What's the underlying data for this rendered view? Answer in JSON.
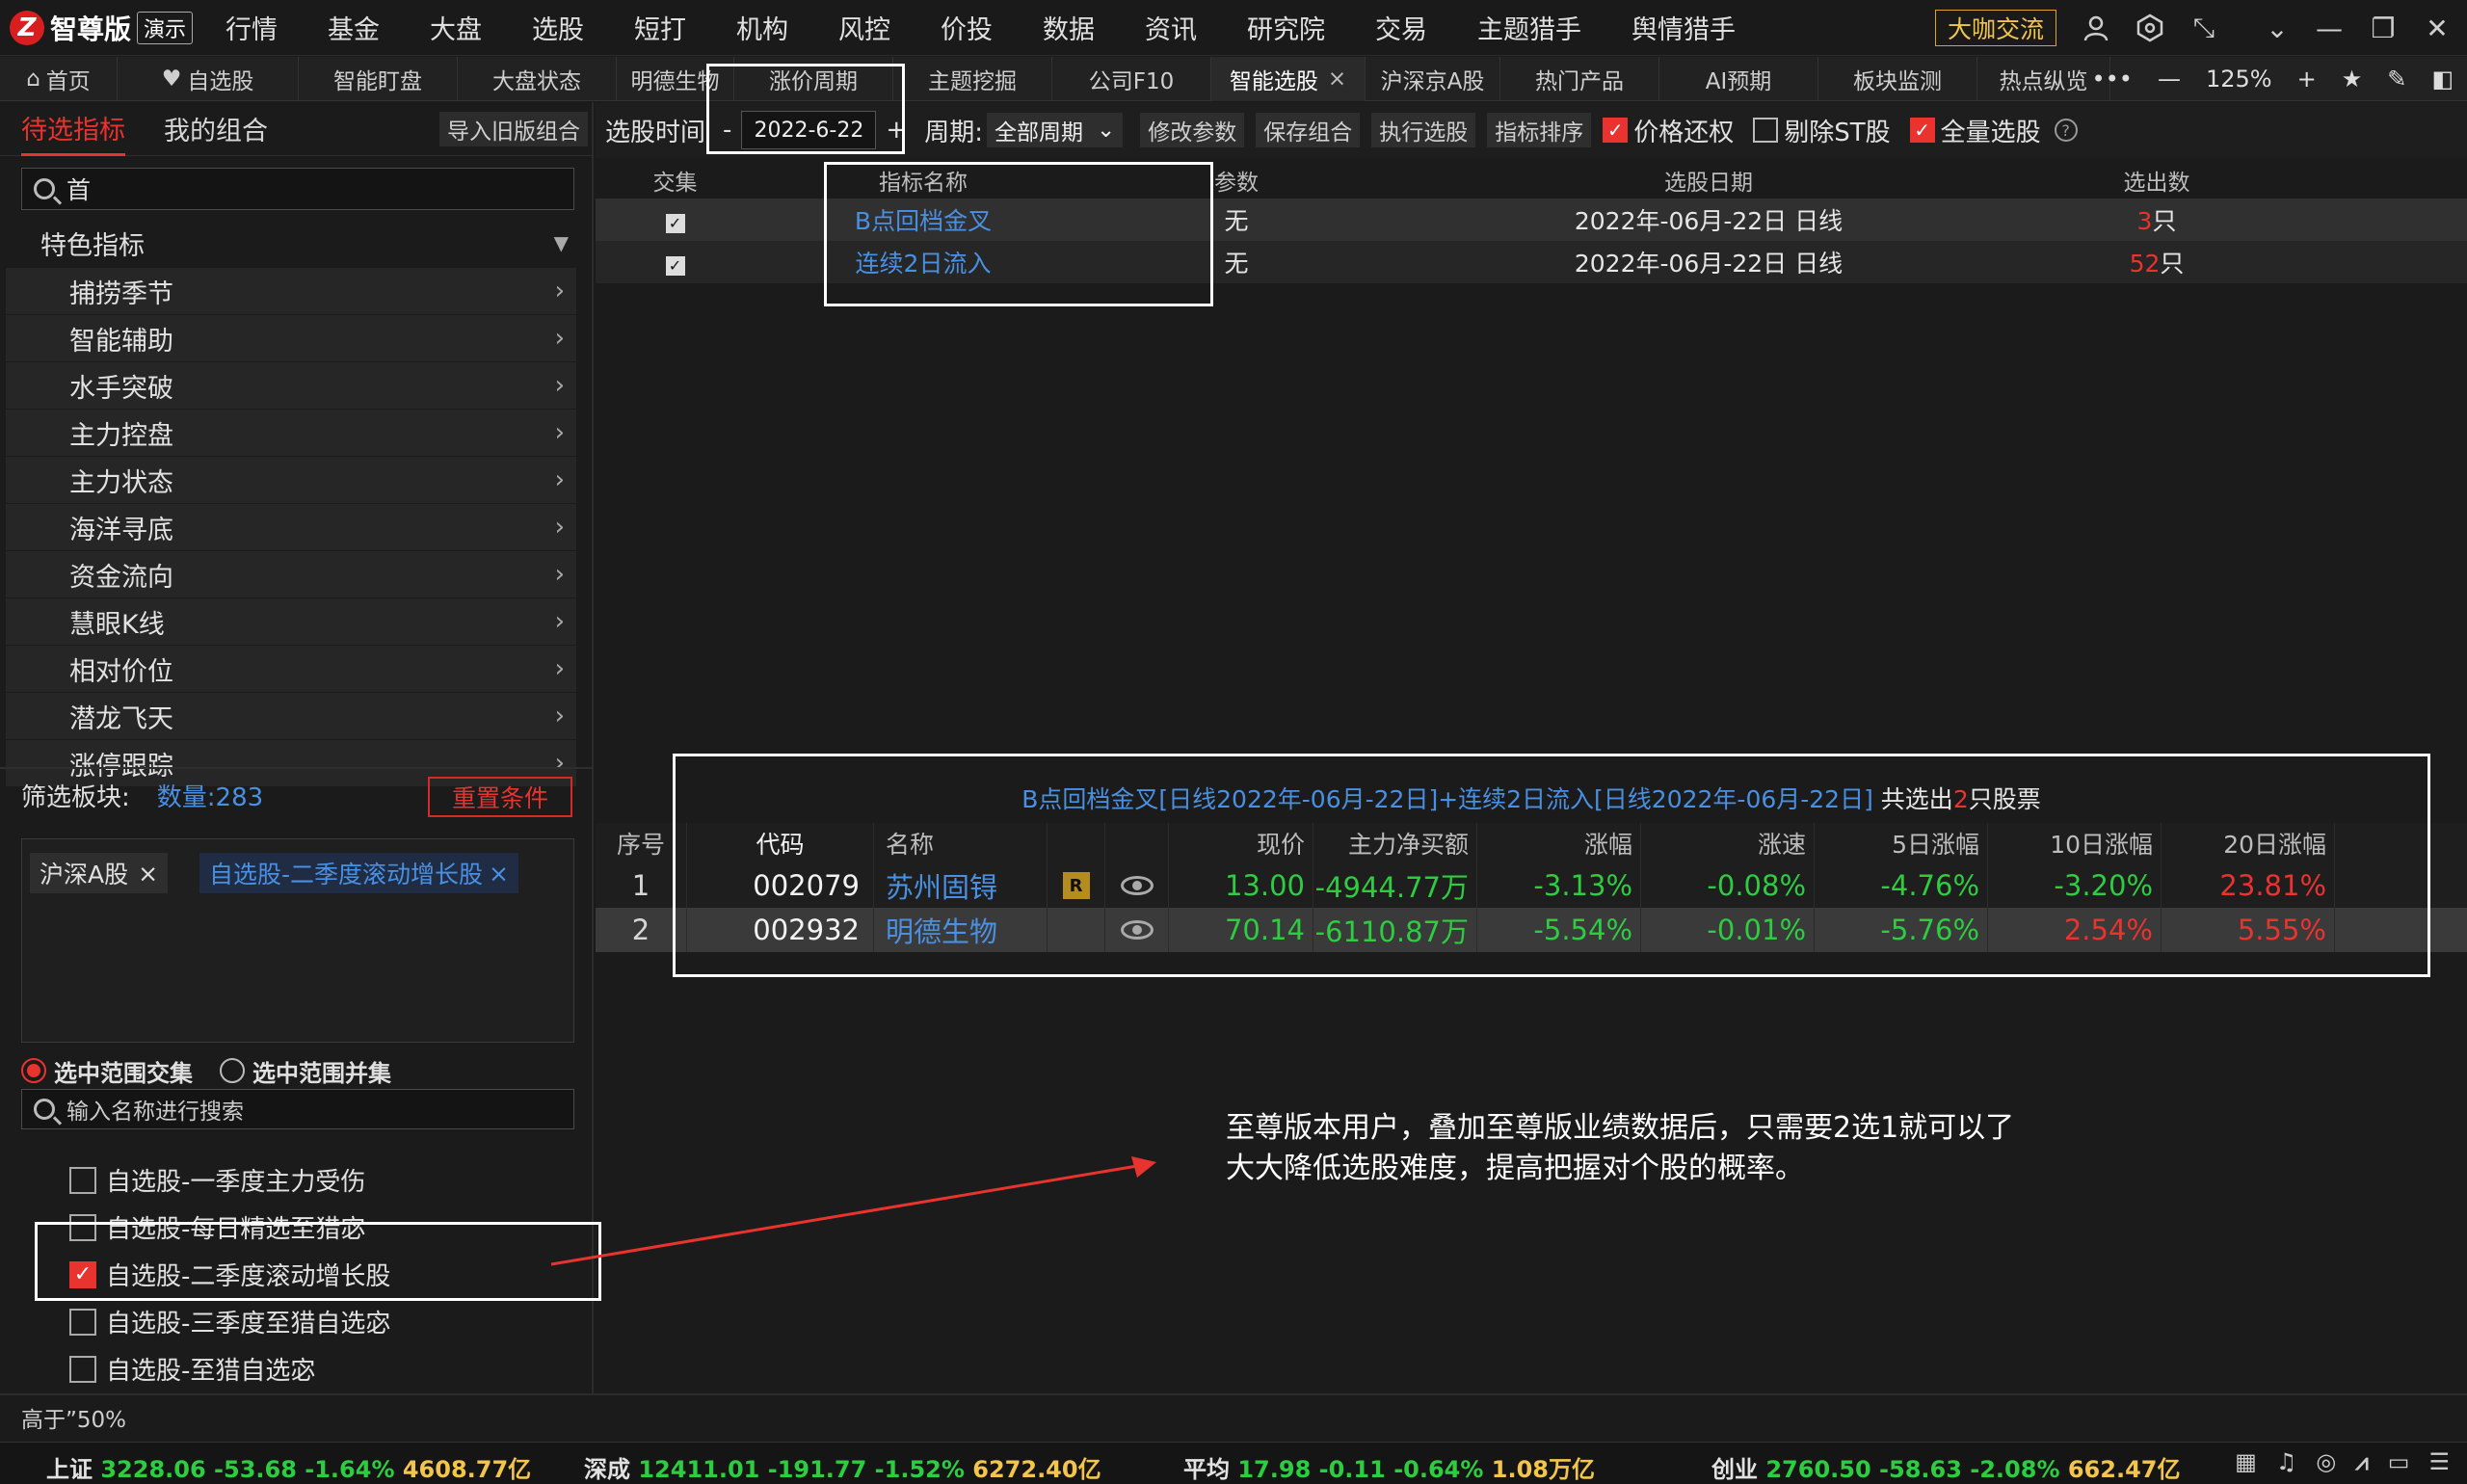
{
  "app": {
    "logo_text": "智尊版",
    "demo_badge": "演示",
    "exchange_btn": "大咖交流"
  },
  "menu": [
    "行情",
    "基金",
    "大盘",
    "选股",
    "短打",
    "机构",
    "风控",
    "价投",
    "数据",
    "资讯",
    "研究院",
    "交易",
    "主题猎手",
    "舆情猎手"
  ],
  "tabs": [
    {
      "label": "首页",
      "icon": "home-icon"
    },
    {
      "label": "自选股",
      "icon": "heart-icon"
    },
    {
      "label": "智能盯盘"
    },
    {
      "label": "大盘状态"
    },
    {
      "label": "明德生物"
    },
    {
      "label": "涨价周期"
    },
    {
      "label": "主题挖掘"
    },
    {
      "label": "公司F10"
    },
    {
      "label": "智能选股",
      "active": true,
      "close": "×"
    },
    {
      "label": "沪深京A股"
    },
    {
      "label": "热门产品"
    },
    {
      "label": "AI预期"
    },
    {
      "label": "板块监测"
    },
    {
      "label": "热点纵览"
    }
  ],
  "tab_tools": {
    "more": "•••",
    "zoom": "125%"
  },
  "left": {
    "tab_pending": "待选指标",
    "tab_mine": "我的组合",
    "import_btn": "导入旧版组合",
    "search_value": "首",
    "category": "特色指标",
    "categories": [
      "捕捞季节",
      "智能辅助",
      "水手突破",
      "主力控盘",
      "主力状态",
      "海洋寻底",
      "资金流向",
      "慧眼K线",
      "相对价位",
      "潜龙飞天",
      "涨停跟踪"
    ],
    "filter_label": "筛选板块:",
    "filter_count": "数量:283",
    "reset_btn": "重置条件",
    "chip1": "沪深A股",
    "chip2": "自选股-二季度滚动增长股",
    "chip_close": "×",
    "radio_intersect": "选中范围交集",
    "radio_union": "选中范围并集",
    "name_search_placeholder": "输入名称进行搜索",
    "checklist": [
      {
        "label": "自选股-一季度主力受伤",
        "checked": false
      },
      {
        "label": "自选股-每日精选至猎宓",
        "checked": false
      },
      {
        "label": "自选股-二季度滚动增长股",
        "checked": true
      },
      {
        "label": "自选股-三季度至猎自选宓",
        "checked": false
      },
      {
        "label": "自选股-至猎自选宓",
        "checked": false
      }
    ]
  },
  "options": {
    "select_time": "选股时间",
    "dash": "-",
    "date": "2022-6-22",
    "plus": "+",
    "period_label": "周期:",
    "period_value": "全部周期",
    "btn_modify": "修改参数",
    "btn_save": "保存组合",
    "btn_run": "执行选股",
    "btn_sort": "指标排序",
    "ck_price_restore": "价格还权",
    "ck_exclude_st": "剔除ST股",
    "ck_full": "全量选股"
  },
  "indicator_table": {
    "headers": [
      "交集",
      "指标名称",
      "参数",
      "选股日期",
      "选出数"
    ],
    "rows": [
      {
        "name": "B点回档金叉",
        "param": "无",
        "date": "2022年-06月-22日 日线",
        "count": "3",
        "unit": "只"
      },
      {
        "name": "连续2日流入",
        "param": "无",
        "date": "2022年-06月-22日 日线",
        "count": "52",
        "unit": "只"
      }
    ]
  },
  "result": {
    "title_main": "B点回档金叉[日线2022年-06月-22日]+连续2日流入[日线2022年-06月-22日]",
    "title_total": " 共选出",
    "title_num": "2",
    "title_unit": "只股票",
    "headers": [
      "序号",
      "代码",
      "名称",
      "",
      "",
      "现价",
      "主力净买额",
      "涨幅",
      "涨速",
      "5日涨幅",
      "10日涨幅",
      "20日涨幅"
    ],
    "rows": [
      {
        "seq": "1",
        "code": "002079",
        "name": "苏州固锝",
        "badge": "R",
        "price": "13.00",
        "flow": "-4944.77万",
        "pct": "-3.13%",
        "speed": "-0.08%",
        "d5": "-4.76%",
        "d10": "-3.20%",
        "d20": "23.81%"
      },
      {
        "seq": "2",
        "code": "002932",
        "name": "明德生物",
        "badge": "",
        "price": "70.14",
        "flow": "-6110.87万",
        "pct": "-5.54%",
        "speed": "-0.01%",
        "d5": "-5.76%",
        "d10": "2.54%",
        "d20": "5.55%"
      }
    ]
  },
  "annotation": {
    "line1": "至尊版本用户，叠加至尊版业绩数据后，只需要2选1就可以了",
    "line2": "大大降低选股难度，提高把握对个股的概率。"
  },
  "status": {
    "text": "高于”50%"
  },
  "ticker": [
    {
      "name": "上证",
      "value": "3228.06",
      "chg": "-53.68",
      "pct": "-1.64%",
      "amount": "4608.77亿"
    },
    {
      "name": "深成",
      "value": "12411.01",
      "chg": "-191.77",
      "pct": "-1.52%",
      "amount": "6272.40亿"
    },
    {
      "name": "平均",
      "value": "17.98",
      "chg": "-0.11",
      "pct": "-0.64%",
      "amount": "1.08万亿"
    },
    {
      "name": "创业",
      "value": "2760.50",
      "chg": "-58.63",
      "pct": "-2.08%",
      "amount": "662.47亿"
    }
  ],
  "colors": {
    "up": "#e8332e",
    "down": "#2ecc40",
    "link": "#4a90e2",
    "accent": "#e8332e"
  }
}
